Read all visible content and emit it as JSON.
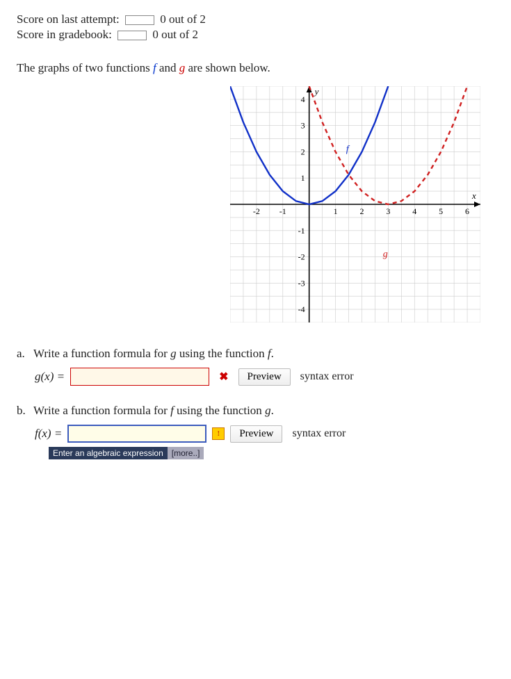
{
  "score": {
    "last_attempt_label": "Score on last attempt:",
    "last_attempt_value": "0 out of 2",
    "gradebook_label": "Score in gradebook:",
    "gradebook_value": "0 out of 2"
  },
  "intro": {
    "prefix": "The graphs of two functions ",
    "f": "f",
    "mid": " and ",
    "g": "g",
    "suffix": " are shown below."
  },
  "chart_data": {
    "type": "line",
    "xlabel": "x",
    "ylabel": "y",
    "xlim": [
      -3,
      6.5
    ],
    "ylim": [
      -4.5,
      4.5
    ],
    "xticks": [
      -2,
      -1,
      1,
      2,
      3,
      4,
      5,
      6
    ],
    "yticks": [
      -4,
      -3,
      -2,
      -1,
      1,
      2,
      3,
      4
    ],
    "series": [
      {
        "name": "f",
        "color": "#1030c8",
        "style": "solid",
        "label_pos": [
          1.4,
          2
        ],
        "points": [
          [
            -3,
            4.5
          ],
          [
            -2.5,
            3.125
          ],
          [
            -2,
            2
          ],
          [
            -1.5,
            1.125
          ],
          [
            -1,
            0.5
          ],
          [
            -0.5,
            0.125
          ],
          [
            0,
            0
          ],
          [
            0.5,
            0.125
          ],
          [
            1,
            0.5
          ],
          [
            1.5,
            1.125
          ],
          [
            2,
            2
          ],
          [
            2.5,
            3.125
          ],
          [
            3,
            4.5
          ]
        ]
      },
      {
        "name": "g",
        "color": "#d02020",
        "style": "dashed",
        "label_pos": [
          2.8,
          -2
        ],
        "points": [
          [
            0,
            4.5
          ],
          [
            0.5,
            3.125
          ],
          [
            1,
            2
          ],
          [
            1.5,
            1.125
          ],
          [
            2,
            0.5
          ],
          [
            2.5,
            0.125
          ],
          [
            3,
            0
          ],
          [
            3.5,
            0.125
          ],
          [
            4,
            0.5
          ],
          [
            4.5,
            1.125
          ],
          [
            5,
            2
          ],
          [
            5.5,
            3.125
          ],
          [
            6,
            4.5
          ]
        ]
      }
    ]
  },
  "questions": {
    "a": {
      "letter": "a.",
      "prompt": "Write a function formula for g using the function f.",
      "lhs": "g(x) =",
      "input_value": "",
      "preview_label": "Preview",
      "error": "syntax error"
    },
    "b": {
      "letter": "b.",
      "prompt": "Write a function formula for f using the function g.",
      "lhs": "f(x) =",
      "input_value": "",
      "preview_label": "Preview",
      "error": "syntax error",
      "hint1": "Enter an algebraic expression",
      "hint2": "[more..]"
    }
  }
}
